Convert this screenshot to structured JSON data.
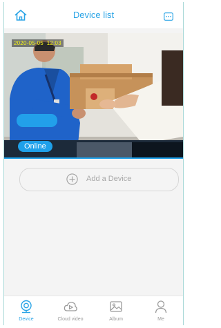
{
  "header": {
    "title": "Device list",
    "home_icon": "home-icon",
    "more_icon": "more-icon"
  },
  "device": {
    "timestamp": "2020-05-05  12:03",
    "status": "Online"
  },
  "add_device": {
    "label": "Add a Device",
    "icon": "plus-circle-icon"
  },
  "tabs": [
    {
      "label": "Device",
      "icon": "camera-icon",
      "active": true
    },
    {
      "label": "Cloud video",
      "icon": "cloud-play-icon",
      "active": false
    },
    {
      "label": "Album",
      "icon": "image-icon",
      "active": false
    },
    {
      "label": "Me",
      "icon": "person-icon",
      "active": false
    }
  ],
  "colors": {
    "accent": "#2aa4e6",
    "badge": "#1ea0ea",
    "inactive_tab": "#9a9a9a"
  }
}
